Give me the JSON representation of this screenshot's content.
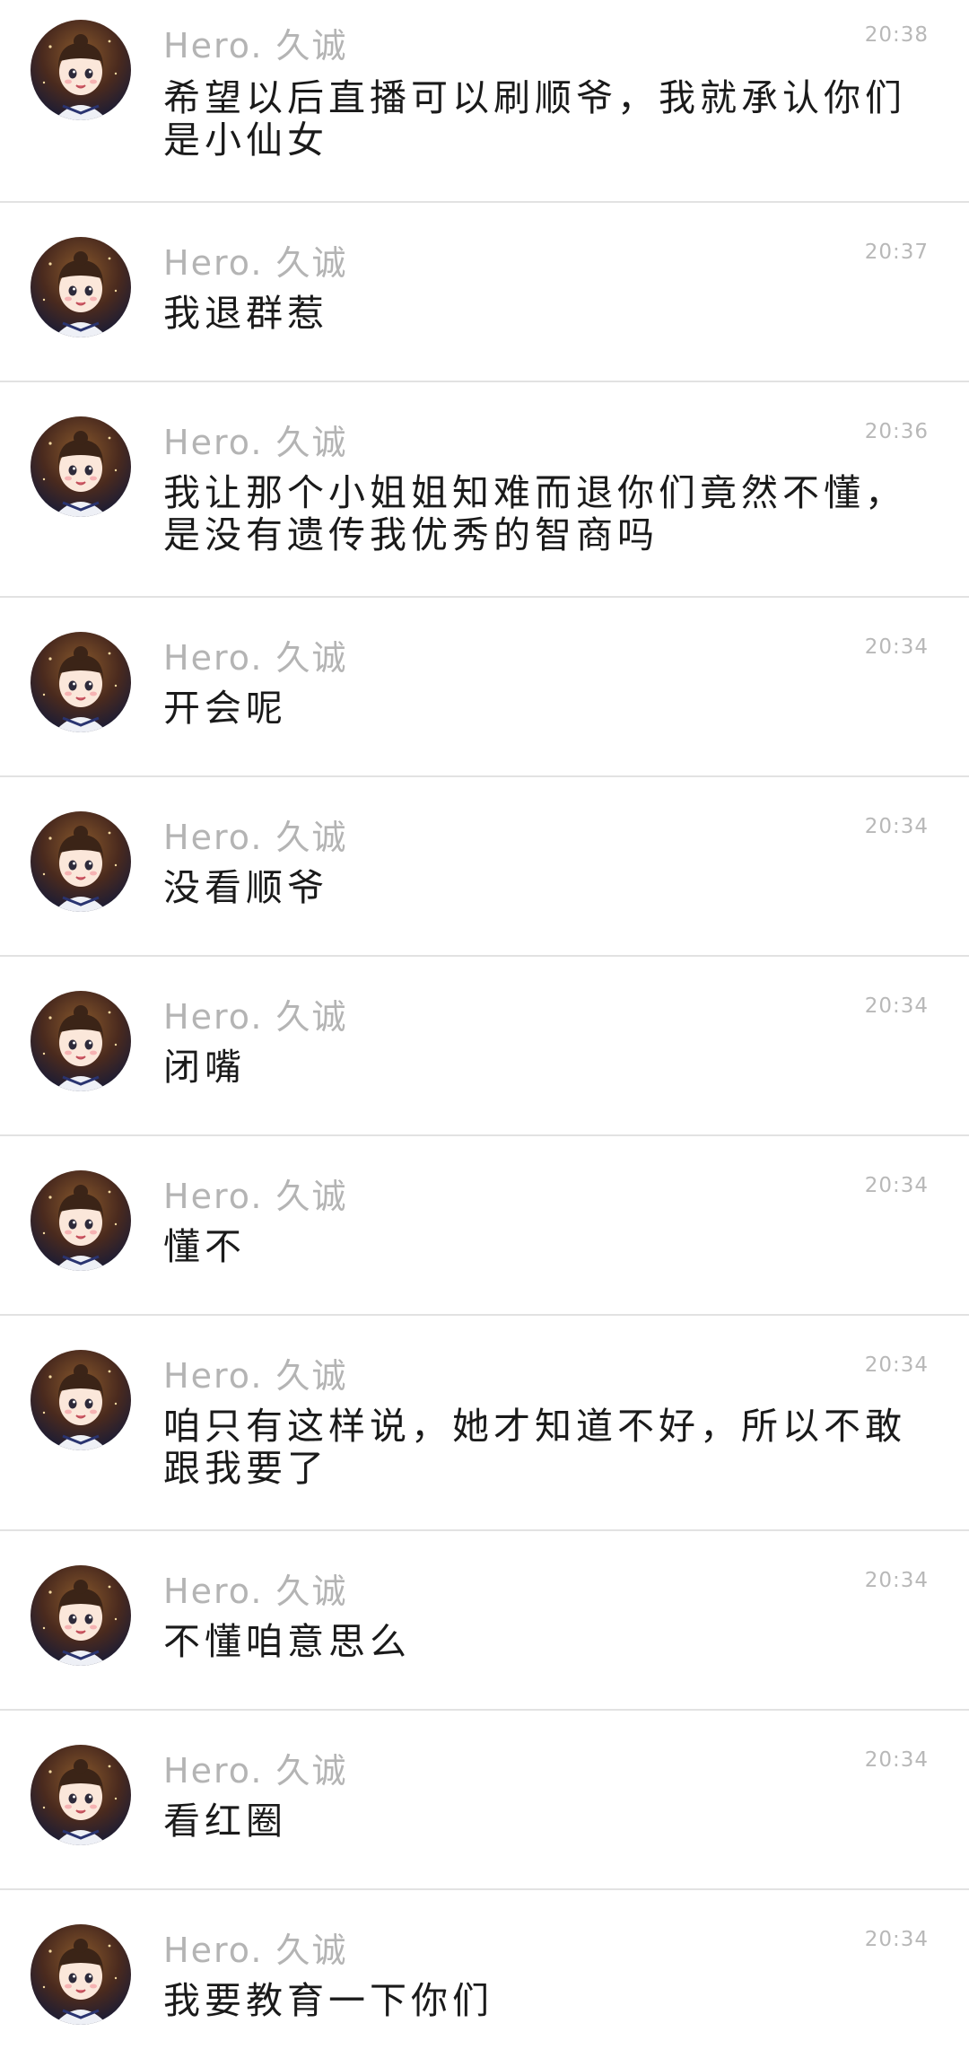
{
  "messages": [
    {
      "name": "Hero. 久诚",
      "time": "20:38",
      "text": "希望以后直播可以刷顺爷，我就承认你们是小仙女",
      "avatar_icon": "cartoon-girl-avatar"
    },
    {
      "name": "Hero. 久诚",
      "time": "20:37",
      "text": "我退群惹",
      "avatar_icon": "cartoon-girl-avatar"
    },
    {
      "name": "Hero. 久诚",
      "time": "20:36",
      "text": "我让那个小姐姐知难而退你们竟然不懂，是没有遗传我优秀的智商吗",
      "avatar_icon": "cartoon-girl-avatar"
    },
    {
      "name": "Hero. 久诚",
      "time": "20:34",
      "text": "开会呢",
      "avatar_icon": "cartoon-girl-avatar"
    },
    {
      "name": "Hero. 久诚",
      "time": "20:34",
      "text": "没看顺爷",
      "avatar_icon": "cartoon-girl-avatar"
    },
    {
      "name": "Hero. 久诚",
      "time": "20:34",
      "text": "闭嘴",
      "avatar_icon": "cartoon-girl-avatar"
    },
    {
      "name": "Hero. 久诚",
      "time": "20:34",
      "text": "懂不",
      "avatar_icon": "cartoon-girl-avatar"
    },
    {
      "name": "Hero. 久诚",
      "time": "20:34",
      "text": "咱只有这样说，她才知道不好，所以不敢跟我要了",
      "avatar_icon": "cartoon-girl-avatar"
    },
    {
      "name": "Hero. 久诚",
      "time": "20:34",
      "text": "不懂咱意思么",
      "avatar_icon": "cartoon-girl-avatar"
    },
    {
      "name": "Hero. 久诚",
      "time": "20:34",
      "text": "看红圈",
      "avatar_icon": "cartoon-girl-avatar"
    },
    {
      "name": "Hero. 久诚",
      "time": "20:34",
      "text": "我要教育一下你们",
      "avatar_icon": "cartoon-girl-avatar"
    }
  ],
  "colors": {
    "background": "#ffffff",
    "divider": "#e2e2e2",
    "name": "#b4b4b4",
    "time": "#b8b8b8",
    "message": "#1a1a1a"
  }
}
